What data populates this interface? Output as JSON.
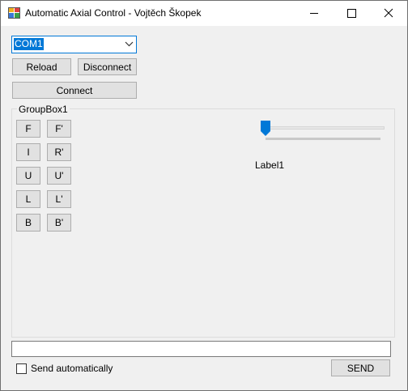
{
  "window": {
    "title": "Automatic Axial Control - Vojtěch Škopek"
  },
  "port": {
    "selected": "COM1"
  },
  "buttons": {
    "reload": "Reload",
    "disconnect": "Disconnect",
    "connect": "Connect",
    "send": "SEND"
  },
  "groupbox": {
    "label": "GroupBox1",
    "moves": [
      {
        "left": "F",
        "right": "F'"
      },
      {
        "left": "I",
        "right": "R'"
      },
      {
        "left": "U",
        "right": "U'"
      },
      {
        "left": "L",
        "right": "L'"
      },
      {
        "left": "B",
        "right": "B'"
      }
    ],
    "label1": "Label1",
    "trackbar_value": 0
  },
  "command": {
    "value": "",
    "auto_send_label": "Send automatically",
    "auto_send_checked": false
  },
  "colors": {
    "accent": "#0078d7",
    "window_bg": "#f0f0f0",
    "button_bg": "#e1e1e1"
  }
}
